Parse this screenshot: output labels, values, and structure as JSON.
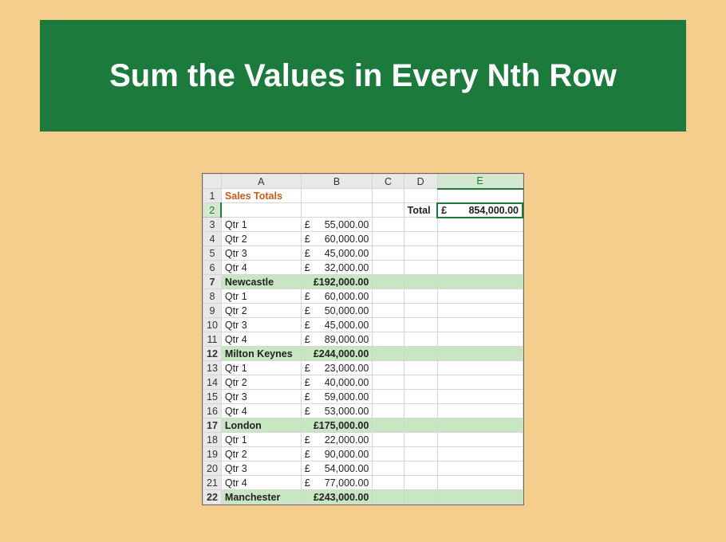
{
  "banner": {
    "title": "Sum the Values in Every Nth Row"
  },
  "sheet": {
    "columns": [
      "A",
      "B",
      "C",
      "D",
      "E"
    ],
    "sales_title": "Sales Totals",
    "total_label": "Total",
    "total_value": "854,000.00",
    "currency": "£",
    "selected_cell": "E2",
    "rows": [
      {
        "num": 1
      },
      {
        "num": 2
      },
      {
        "num": 3,
        "label": "Qtr 1",
        "value": "55,000.00"
      },
      {
        "num": 4,
        "label": "Qtr 2",
        "value": "60,000.00"
      },
      {
        "num": 5,
        "label": "Qtr 3",
        "value": "45,000.00"
      },
      {
        "num": 6,
        "label": "Qtr 4",
        "value": "32,000.00"
      },
      {
        "num": 7,
        "label": "Newcastle",
        "value": "192,000.00",
        "subtotal": true
      },
      {
        "num": 8,
        "label": "Qtr 1",
        "value": "60,000.00"
      },
      {
        "num": 9,
        "label": "Qtr 2",
        "value": "50,000.00"
      },
      {
        "num": 10,
        "label": "Qtr 3",
        "value": "45,000.00"
      },
      {
        "num": 11,
        "label": "Qtr 4",
        "value": "89,000.00"
      },
      {
        "num": 12,
        "label": "Milton Keynes",
        "value": "244,000.00",
        "subtotal": true
      },
      {
        "num": 13,
        "label": "Qtr 1",
        "value": "23,000.00"
      },
      {
        "num": 14,
        "label": "Qtr 2",
        "value": "40,000.00"
      },
      {
        "num": 15,
        "label": "Qtr 3",
        "value": "59,000.00"
      },
      {
        "num": 16,
        "label": "Qtr 4",
        "value": "53,000.00"
      },
      {
        "num": 17,
        "label": "London",
        "value": "175,000.00",
        "subtotal": true
      },
      {
        "num": 18,
        "label": "Qtr 1",
        "value": "22,000.00"
      },
      {
        "num": 19,
        "label": "Qtr 2",
        "value": "90,000.00"
      },
      {
        "num": 20,
        "label": "Qtr 3",
        "value": "54,000.00"
      },
      {
        "num": 21,
        "label": "Qtr 4",
        "value": "77,000.00"
      },
      {
        "num": 22,
        "label": "Manchester",
        "value": "243,000.00",
        "subtotal": true
      }
    ]
  }
}
